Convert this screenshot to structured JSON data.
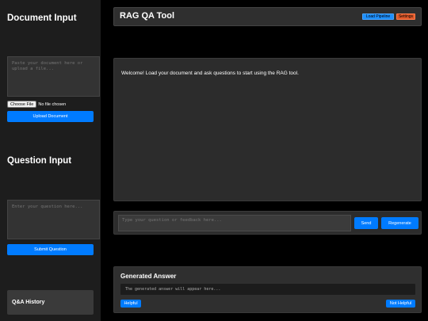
{
  "sidebar": {
    "document_title": "Document Input",
    "document_placeholder": "Paste your document here or upload a file...",
    "choose_file_label": "Choose File",
    "no_file_label": "No file chosen",
    "upload_label": "Upload Document",
    "question_title": "Question Input",
    "question_placeholder": "Enter your question here...",
    "submit_label": "Submit Question",
    "history_label": "Q&A History"
  },
  "header": {
    "title": "RAG QA Tool",
    "load_pipeline_label": "Load Pipeline",
    "settings_label": "Settings"
  },
  "chat": {
    "welcome_message": "Welcome! Load your document and ask questions to start using the RAG tool."
  },
  "input_bar": {
    "placeholder": "Type your question or feedback here...",
    "send_label": "Send",
    "regenerate_label": "Regenerate"
  },
  "answer": {
    "title": "Generated Answer",
    "placeholder_text": "The generated answer will appear here...",
    "helpful_label": "Helpful",
    "not_helpful_label": "Not Helpful"
  },
  "colors": {
    "accent": "#007bff",
    "settings": "#e05a2b",
    "sidebar_bg": "#1d1d1d",
    "panel_bg": "#2c2c2c"
  }
}
